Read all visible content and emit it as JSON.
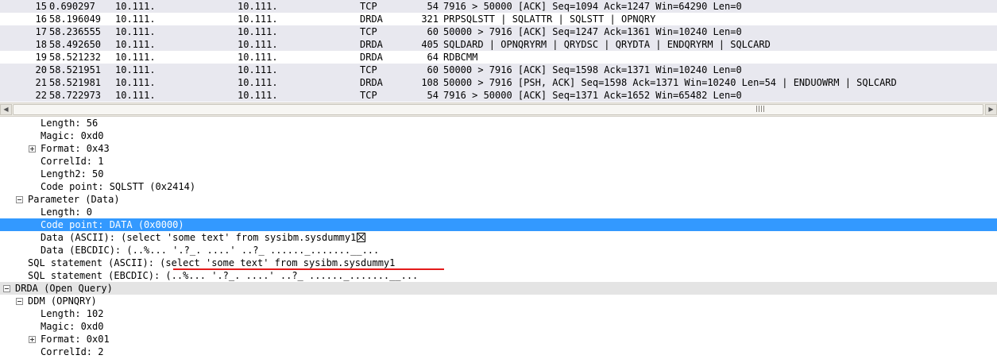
{
  "packet_list": {
    "rows": [
      {
        "no": "15",
        "time": "0.690297",
        "src": "10.111.",
        "dst": "10.111.",
        "proto": "TCP",
        "len": "54",
        "info": "7916 > 50000 [ACK] Seq=1094 Ack=1247 Win=64290 Len=0",
        "bg": "#e8e8ef"
      },
      {
        "no": "16",
        "time": "58.196049",
        "src": "10.111.",
        "dst": "10.111.",
        "proto": "DRDA",
        "len": "321",
        "info": "PRPSQLSTT | SQLATTR | SQLSTT | OPNQRY",
        "bg": "#ffffff"
      },
      {
        "no": "17",
        "time": "58.236555",
        "src": "10.111.",
        "dst": "10.111.",
        "proto": "TCP",
        "len": "60",
        "info": "50000 > 7916 [ACK] Seq=1247 Ack=1361 Win=10240 Len=0",
        "bg": "#e8e8ef"
      },
      {
        "no": "18",
        "time": "58.492650",
        "src": "10.111.",
        "dst": "10.111.",
        "proto": "DRDA",
        "len": "405",
        "info": "SQLDARD | OPNQRYRM | QRYDSC | QRYDTA | ENDQRYRM | SQLCARD",
        "bg": "#e8e8ef"
      },
      {
        "no": "19",
        "time": "58.521232",
        "src": "10.111.",
        "dst": "10.111.",
        "proto": "DRDA",
        "len": "64",
        "info": "RDBCMM",
        "bg": "#ffffff"
      },
      {
        "no": "20",
        "time": "58.521951",
        "src": "10.111.",
        "dst": "10.111.",
        "proto": "TCP",
        "len": "60",
        "info": "50000 > 7916 [ACK] Seq=1598 Ack=1371 Win=10240 Len=0",
        "bg": "#e8e8ef"
      },
      {
        "no": "21",
        "time": "58.521981",
        "src": "10.111.",
        "dst": "10.111.",
        "proto": "DRDA",
        "len": "108",
        "info": "50000 > 7916 [PSH, ACK] Seq=1598 Ack=1371 Win=10240 Len=54 | ENDUOWRM | SQLCARD",
        "bg": "#e8e8ef"
      },
      {
        "no": "22",
        "time": "58.722973",
        "src": "10.111.",
        "dst": "10.111.",
        "proto": "TCP",
        "len": "54",
        "info": "7916 > 50000 [ACK] Seq=1371 Ack=1652 Win=65482 Len=0",
        "bg": "#e8e8ef"
      }
    ]
  },
  "detail_tree": {
    "rows": [
      {
        "text": "Length: 56",
        "expander": "none"
      },
      {
        "text": "Magic: 0xd0",
        "expander": "none"
      },
      {
        "text": "Format: 0x43",
        "expander": "plus"
      },
      {
        "text": "CorrelId: 1",
        "expander": "none"
      },
      {
        "text": "Length2: 50",
        "expander": "none"
      },
      {
        "text": "Code point: SQLSTT (0x2414)",
        "expander": "none"
      },
      {
        "text": "Parameter (Data)",
        "expander": "minus"
      },
      {
        "text": "Length: 0",
        "expander": "none"
      },
      {
        "text": "Code point: DATA (0x0000)",
        "expander": "none",
        "selected": true
      },
      {
        "text": "Data (ASCII): (select 'some text' from sysibm.sysdummy1",
        "expander": "none",
        "trailing_glyph": "box-x-icon"
      },
      {
        "text": "Data (EBCDIC): (..%... '.?_. ....' ..?_ ......_.......__...",
        "expander": "none"
      },
      {
        "text": "SQL statement (ASCII): (select 'some text' from sysibm.sysdummy1",
        "expander": "none",
        "annotated": true
      },
      {
        "text": "SQL statement (EBCDIC): (..%... '.?_. ....' ..?_ ......_.......__...",
        "expander": "none"
      },
      {
        "text": "DRDA (Open Query)",
        "expander": "minus",
        "banded": true
      },
      {
        "text": "DDM (OPNQRY)",
        "expander": "minus"
      },
      {
        "text": "Length: 102",
        "expander": "none"
      },
      {
        "text": "Magic: 0xd0",
        "expander": "none"
      },
      {
        "text": "Format: 0x01",
        "expander": "plus"
      },
      {
        "text": "CorrelId: 2",
        "expander": "none"
      }
    ]
  },
  "colors": {
    "selection": "#3399ff",
    "annotation_underline": "#e31b1b",
    "row_band": "#e8e8ef"
  }
}
